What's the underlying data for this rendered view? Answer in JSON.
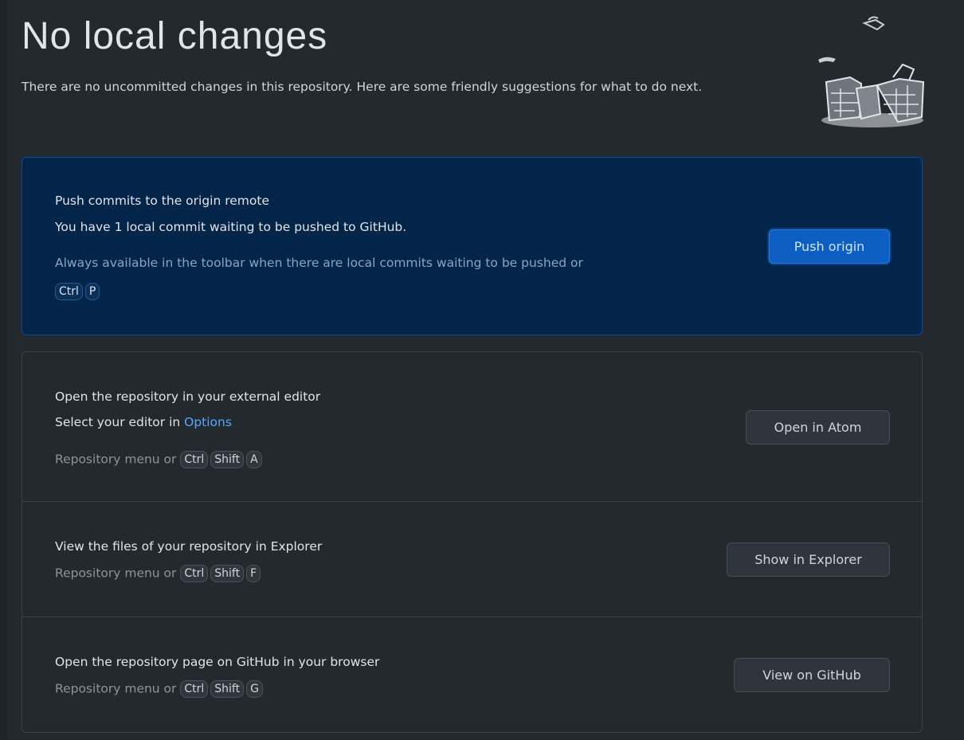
{
  "header": {
    "title": "No local changes",
    "subtitle": "There are no uncommitted changes in this repository. Here are some friendly suggestions for what to do next."
  },
  "push_card": {
    "title": "Push commits to the origin remote",
    "description": "You have 1 local commit waiting to be pushed to GitHub.",
    "hint": "Always available in the toolbar when there are local commits waiting to be pushed or",
    "shortcut": [
      "Ctrl",
      "P"
    ],
    "button_label": "Push origin"
  },
  "editor_card": {
    "title": "Open the repository in your external editor",
    "description_prefix": "Select your editor in ",
    "description_link": "Options",
    "hint": "Repository menu or",
    "shortcut": [
      "Ctrl",
      "Shift",
      "A"
    ],
    "button_label": "Open in Atom"
  },
  "explorer_card": {
    "title": "View the files of your repository in Explorer",
    "hint": "Repository menu or",
    "shortcut": [
      "Ctrl",
      "Shift",
      "F"
    ],
    "button_label": "Show in Explorer"
  },
  "github_card": {
    "title": "Open the repository page on GitHub in your browser",
    "hint": "Repository menu or",
    "shortcut": [
      "Ctrl",
      "Shift",
      "G"
    ],
    "button_label": "View on GitHub"
  },
  "colors": {
    "background": "#24292e",
    "highlight_card": "#04254a",
    "primary_button": "#0d5ec2",
    "link": "#58a6ff"
  }
}
